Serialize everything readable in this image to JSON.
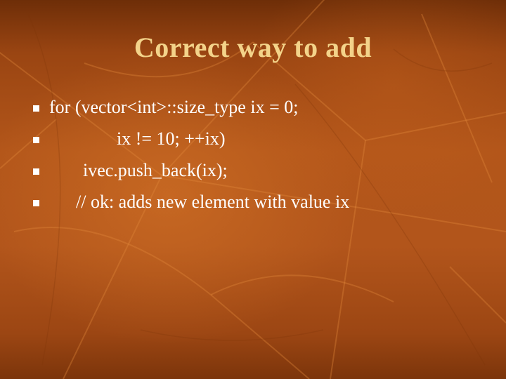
{
  "slide": {
    "title": "Correct way to add",
    "background_color": "#b3561a",
    "title_color": "#f3d38a",
    "text_color": "#ffffff",
    "bullet_icon": "square-bullet-icon",
    "bullets": [
      {
        "text": "for (vector<int>::size_type ix = 0;"
      },
      {
        "text": "ix != 10; ++ix)"
      },
      {
        "text": "ivec.push_back(ix);"
      },
      {
        "text": "// ok: adds new element with value ix"
      }
    ]
  }
}
